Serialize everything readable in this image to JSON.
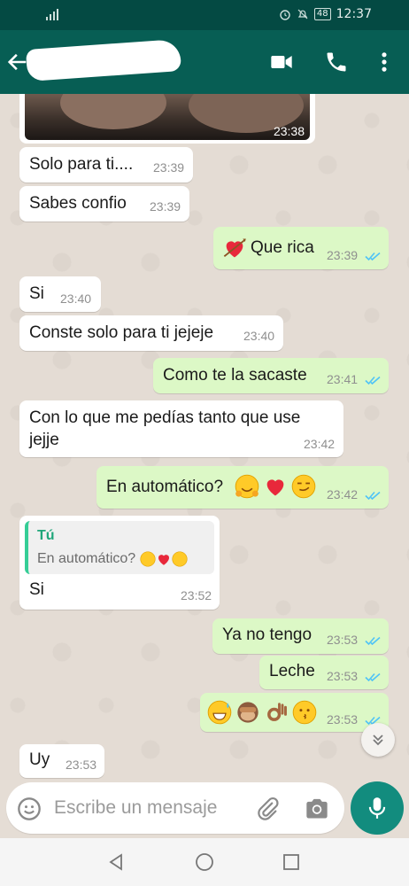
{
  "status_bar": {
    "time": "12:37",
    "battery": "48"
  },
  "header": {
    "icons": [
      "back-arrow-icon",
      "video-call-icon",
      "phone-icon",
      "more-options-icon"
    ]
  },
  "messages": [
    {
      "kind": "image",
      "direction": "in",
      "time": "23:38"
    },
    {
      "direction": "in",
      "text": "Solo para ti....",
      "time": "23:39"
    },
    {
      "direction": "in",
      "text": "Sabes confio",
      "time": "23:39"
    },
    {
      "direction": "out",
      "text": "Que rica",
      "time": "23:39",
      "emoji": "heart-with-arrow",
      "read": true
    },
    {
      "direction": "in",
      "text": "Si",
      "time": "23:40"
    },
    {
      "direction": "in",
      "text": "Conste solo para ti jejeje",
      "time": "23:40"
    },
    {
      "direction": "out",
      "text": "Como te la sacaste",
      "time": "23:41",
      "read": true
    },
    {
      "direction": "in",
      "text_line1": "Con lo que me pedías tanto que use",
      "text_line2": "jejje",
      "time": "23:42"
    },
    {
      "direction": "out",
      "text": "En automático?",
      "time": "23:42",
      "emojis": [
        "hugging-face",
        "red-heart",
        "smirking-face"
      ],
      "read": true
    },
    {
      "direction": "in",
      "quoted_author": "Tú",
      "quoted_text": "En automático?",
      "text": "Si",
      "time": "23:52"
    },
    {
      "direction": "out",
      "text": "Ya no tengo",
      "time": "23:53",
      "read": true
    },
    {
      "direction": "out",
      "text": "Leche",
      "time": "23:53",
      "read": true
    },
    {
      "direction": "out",
      "text": "",
      "time": "23:53",
      "emojis": [
        "grinning-sweat",
        "see-no-evil-monkey",
        "ok-hand",
        "kissing-face"
      ],
      "read": true
    },
    {
      "direction": "in",
      "text": "Uy",
      "time": "23:53"
    }
  ],
  "composer": {
    "placeholder": "Escribe un mensaje"
  },
  "colors": {
    "header": "#075e54",
    "status_bar": "#044a43",
    "outgoing": "#dcf8c6",
    "incoming": "#ffffff",
    "read_ticks": "#4fc3f7",
    "accent": "#128c7e"
  }
}
